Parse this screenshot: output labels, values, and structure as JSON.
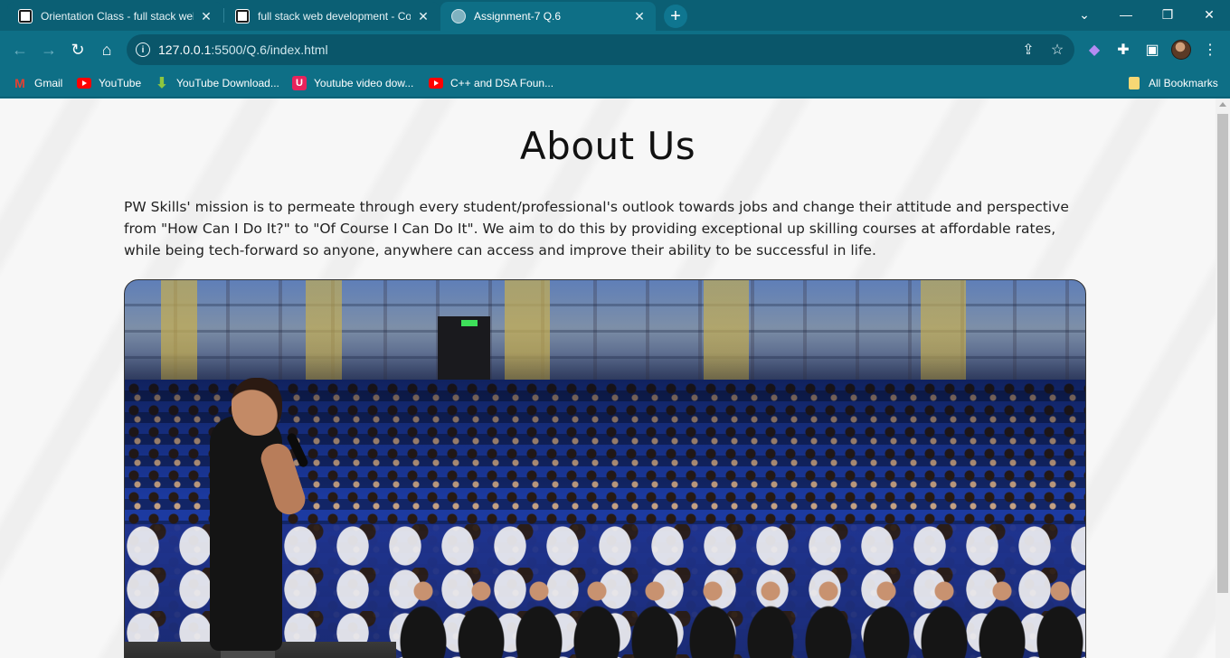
{
  "browser": {
    "tabs": [
      {
        "title": "Orientation Class - full stack web",
        "active": false
      },
      {
        "title": "full stack web development - Co",
        "active": false
      },
      {
        "title": "Assignment-7 Q.6",
        "active": true
      }
    ],
    "address": {
      "host": "127.0.0.1",
      "path": ":5500/Q.6/index.html"
    },
    "bookmarks": [
      {
        "label": "Gmail",
        "icon": "gmail-icon"
      },
      {
        "label": "YouTube",
        "icon": "youtube-icon"
      },
      {
        "label": "YouTube Download...",
        "icon": "download-icon"
      },
      {
        "label": "Youtube video dow...",
        "icon": "u-icon"
      },
      {
        "label": "C++ and DSA Foun...",
        "icon": "youtube-icon"
      }
    ],
    "all_bookmarks_label": "All Bookmarks"
  },
  "page": {
    "heading": "About Us",
    "paragraph": "PW Skills' mission is to permeate through every student/professional's outlook towards jobs and change their attitude and perspective from \"How Can I Do It?\" to \"Of Course I Can Do It\". We aim to do this by providing exceptional up skilling courses at affordable rates, while being tech-forward so anyone, anywhere can access and improve their ability to be successful in life."
  },
  "colors": {
    "chrome_frame": "#0b5f74",
    "chrome_toolbar": "#0e6f86",
    "page_background": "#f7f7f7"
  }
}
